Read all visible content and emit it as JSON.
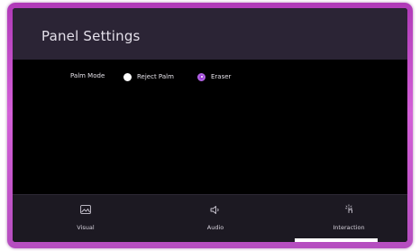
{
  "panel": {
    "title": "Panel Settings"
  },
  "setting": {
    "label": "Palm Mode",
    "options": [
      {
        "label": "Reject Palm",
        "selected": false
      },
      {
        "label": "Eraser",
        "selected": true
      }
    ]
  },
  "nav": {
    "items": [
      {
        "label": "Visual",
        "icon": "image-icon"
      },
      {
        "label": "Audio",
        "icon": "speaker-icon"
      },
      {
        "label": "Interaction",
        "icon": "touch-icon",
        "active": true
      }
    ]
  },
  "colors": {
    "frame": "#c24ec8",
    "header": "#2b2435",
    "nav_bg": "#1c1922",
    "selected_radio": "#9b3fd4"
  }
}
